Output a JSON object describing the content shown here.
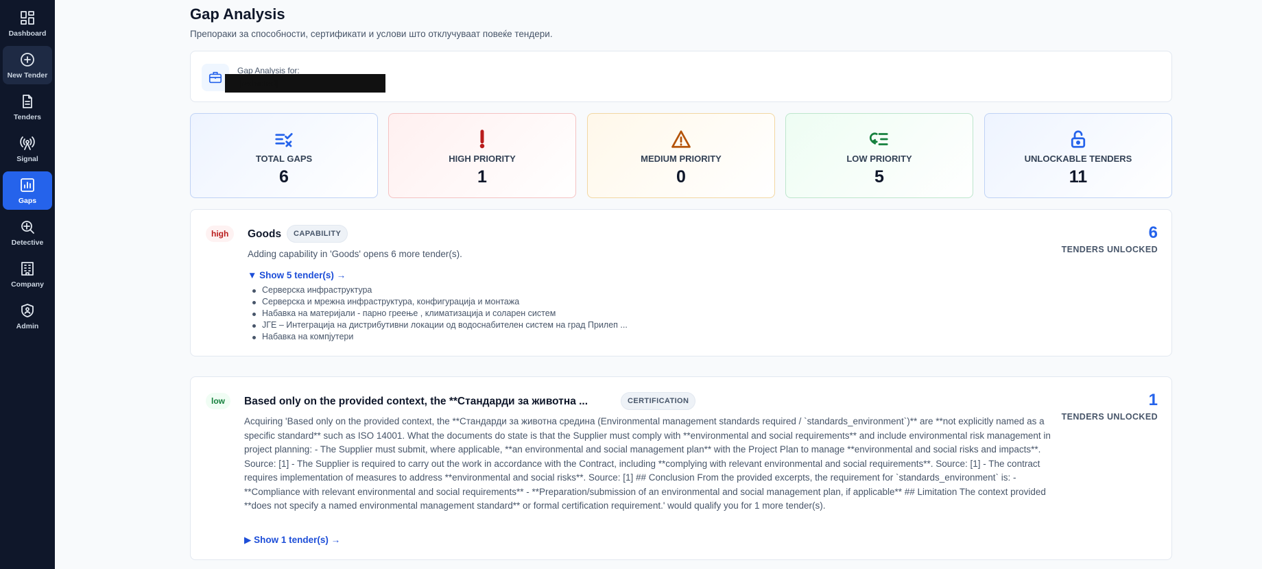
{
  "sidebar": {
    "items": [
      {
        "label": "Dashboard",
        "icon": "dashboard-icon"
      },
      {
        "label": "New Tender",
        "icon": "plus-circle-icon"
      },
      {
        "label": "Tenders",
        "icon": "document-icon"
      },
      {
        "label": "Signal",
        "icon": "signal-icon"
      },
      {
        "label": "Gaps",
        "icon": "chart-icon",
        "active": true
      },
      {
        "label": "Detective",
        "icon": "detective-icon"
      },
      {
        "label": "Company",
        "icon": "building-icon"
      },
      {
        "label": "Admin",
        "icon": "shield-user-icon"
      }
    ]
  },
  "header": {
    "title": "Gap Analysis",
    "subtitle": "Препораки за способности, сертификати и услови што отклучуваат повеќе тендери."
  },
  "company": {
    "label": "Gap Analysis for:",
    "name": "[redacted]"
  },
  "stats": {
    "total": {
      "label": "TOTAL GAPS",
      "value": "6",
      "color": "#2563eb"
    },
    "high": {
      "label": "HIGH PRIORITY",
      "value": "1",
      "color": "#b91c1c"
    },
    "medium": {
      "label": "MEDIUM PRIORITY",
      "value": "0",
      "color": "#b45309"
    },
    "low": {
      "label": "LOW PRIORITY",
      "value": "5",
      "color": "#15803d"
    },
    "unlockable": {
      "label": "UNLOCKABLE TENDERS",
      "value": "11",
      "color": "#2563eb"
    }
  },
  "gaps": [
    {
      "priority": "high",
      "title": "Goods",
      "type": "CAPABILITY",
      "description": "Adding capability in 'Goods' opens 6 more tender(s).",
      "toggle": "▼ Show 5 tender(s) →",
      "tenders": [
        "Серверска инфраструктура",
        "Серверска и мрежна инфраструктура, конфигурација и монтажа",
        "Набавка на материјали - парно греење , климатизација и соларен систем",
        "ЈГЕ – Интеграција на дистрибутивни локации од водоснабителен систем на град Прилеп ...",
        "Набавка на компјутери"
      ],
      "unlocked_count": "6",
      "unlocked_label": "TENDERS UNLOCKED"
    },
    {
      "priority": "low",
      "title": "Based only on the provided context, the **Стандарди за животна ...",
      "type": "CERTIFICATION",
      "description": "Acquiring 'Based only on the provided context, the **Стандарди за животна средина (Environmental management standards required / `standards_environment`)** are **not explicitly named as a specific standard** such as ISO 14001. What the documents do state is that the Supplier must comply with **environmental and social requirements** and include environmental risk management in project planning: - The Supplier must submit, where applicable, **an environmental and social management plan** with the Project Plan to manage **environmental and social risks and impacts**. Source: [1] - The Supplier is required to carry out the work in accordance with the Contract, including **complying with relevant environmental and social requirements**. Source: [1] - The contract requires implementation of measures to address **environmental and social risks**. Source: [1] ## Conclusion From the provided excerpts, the requirement for `standards_environment` is: - **Compliance with relevant environmental and social requirements** - **Preparation/submission of an environmental and social management plan, if applicable** ## Limitation The context provided **does not specify a named environmental management standard** or formal certification requirement.' would qualify you for 1 more tender(s).",
      "toggle": "▶ Show 1 tender(s) →",
      "unlocked_count": "1",
      "unlocked_label": "TENDERS UNLOCKED"
    }
  ]
}
